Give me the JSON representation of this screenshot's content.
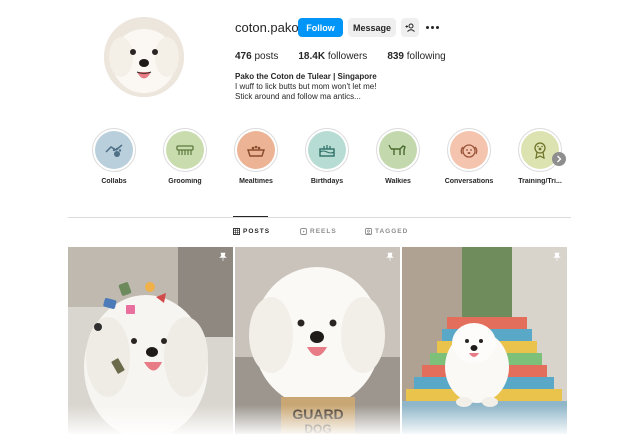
{
  "profile": {
    "username": "coton.pako",
    "follow_label": "Follow",
    "message_label": "Message",
    "suggest_label": "+ᴬ",
    "stats": {
      "posts_count": "476",
      "posts_label": "posts",
      "followers_count": "18.4K",
      "followers_label": "followers",
      "following_count": "839",
      "following_label": "following"
    },
    "bio": {
      "name": "Pako the Coton de Tulear | Singapore",
      "line1": "I wuff to lick butts but mom won't let me!",
      "line2": "Stick around and follow ma antics..."
    }
  },
  "highlights": [
    {
      "label": "Collabs",
      "icon": "handshake-paw-icon",
      "color": "#b9cfdc"
    },
    {
      "label": "Grooming",
      "icon": "comb-icon",
      "color": "#c9dcae"
    },
    {
      "label": "Mealtimes",
      "icon": "food-bowl-icon",
      "color": "#ecb494"
    },
    {
      "label": "Birthdays",
      "icon": "cake-icon",
      "color": "#b6dcd4"
    },
    {
      "label": "Walkies",
      "icon": "dog-walk-icon",
      "color": "#c3d8ad"
    },
    {
      "label": "Conversations",
      "icon": "dog-face-icon",
      "color": "#f4c4ae"
    },
    {
      "label": "Training/Tri...",
      "icon": "award-ribbon-icon",
      "color": "#dde3b0"
    }
  ],
  "tabs": {
    "posts": "POSTS",
    "reels": "REELS",
    "tagged": "TAGGED"
  },
  "colors": {
    "accent": "#0095f6",
    "text": "#262626",
    "muted": "#8e8e8e",
    "border": "#dbdbdb"
  }
}
